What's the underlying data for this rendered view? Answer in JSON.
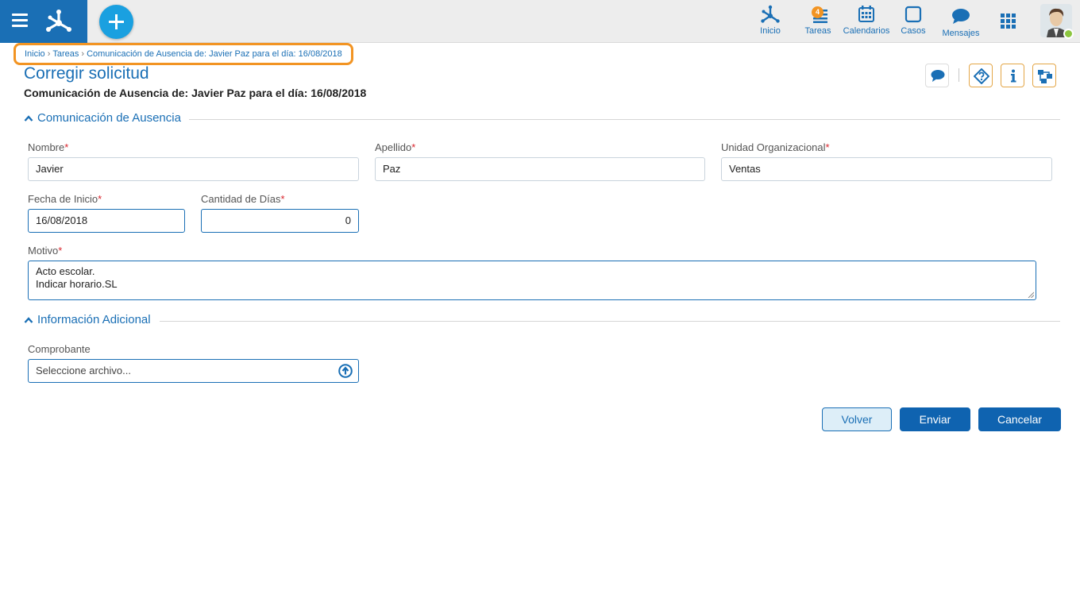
{
  "nav": {
    "inicio": "Inicio",
    "tareas": "Tareas",
    "tareas_badge": "4",
    "calendarios": "Calendarios",
    "casos": "Casos",
    "mensajes": "Mensajes"
  },
  "breadcrumb": {
    "items": [
      "Inicio",
      "Tareas",
      "Comunicación de Ausencia de: Javier Paz para el día: 16/08/2018"
    ],
    "separator": "›"
  },
  "page": {
    "title": "Corregir solicitud",
    "subtitle": "Comunicación de Ausencia de: Javier Paz para el día: 16/08/2018"
  },
  "section1": {
    "title": "Comunicación de Ausencia",
    "nombre_label": "Nombre",
    "nombre_value": "Javier",
    "apellido_label": "Apellido",
    "apellido_value": "Paz",
    "unidad_label": "Unidad Organizacional",
    "unidad_value": "Ventas",
    "fecha_label": "Fecha de Inicio",
    "fecha_value": "16/08/2018",
    "dias_label": "Cantidad de Días",
    "dias_value": "0",
    "motivo_label": "Motivo",
    "motivo_lines": [
      "Acto escolar.",
      "Indicar horario.SL"
    ],
    "required_mark": "*"
  },
  "section2": {
    "title": "Información Adicional",
    "comprobante_label": "Comprobante",
    "comprobante_placeholder": "Seleccione archivo..."
  },
  "actions": {
    "volver": "Volver",
    "enviar": "Enviar",
    "cancelar": "Cancelar"
  },
  "colors": {
    "brand": "#1a6fb5",
    "accent": "#1aa0e0",
    "highlight": "#f29423",
    "required": "#d9262e",
    "online": "#8cc63f"
  },
  "icons": {
    "menu": "hamburger-menu-icon",
    "logo": "app-logo",
    "add": "plus-icon",
    "inicio": "network-icon",
    "tareas": "tasks-icon",
    "calendarios": "calendar-icon",
    "casos": "square-icon",
    "mensajes": "chat-bubble-icon",
    "apps": "grid-icon",
    "comments": "comment-icon",
    "help": "help-icon",
    "info": "info-icon",
    "flow": "workflow-icon",
    "upload": "upload-icon"
  }
}
